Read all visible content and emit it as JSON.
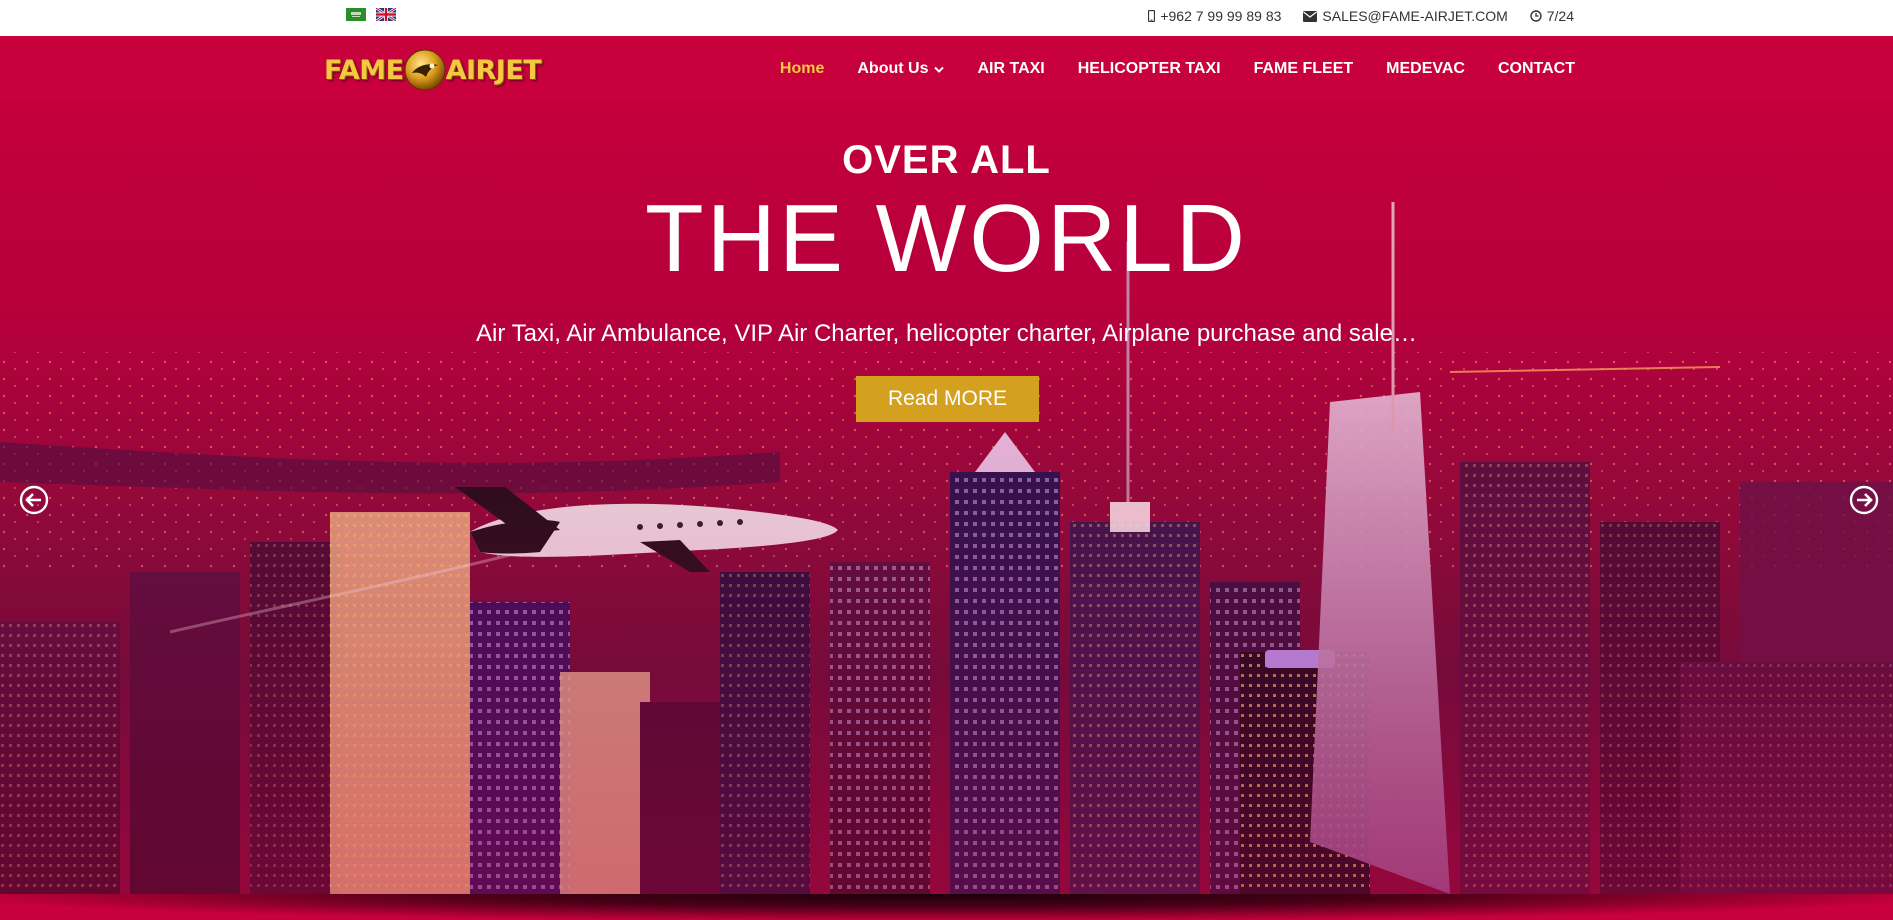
{
  "topbar": {
    "flags": [
      {
        "name": "arabic-flag-icon",
        "color": "#2a8c2a"
      },
      {
        "name": "uk-flag-icon",
        "color": "#1a3a8a"
      }
    ],
    "phone": "+962 7 99 99 89 83",
    "email": "SALES@FAME-AIRJET.COM",
    "hours": "7/24"
  },
  "navbar": {
    "logo_left": "FAME",
    "logo_right": "AIRJET",
    "items": [
      {
        "label": "Home",
        "active": true
      },
      {
        "label": "About Us",
        "dropdown": true
      },
      {
        "label": "AIR TAXI"
      },
      {
        "label": "HELICOPTER TAXI"
      },
      {
        "label": "FAME FLEET"
      },
      {
        "label": "MEDEVAC"
      },
      {
        "label": "CONTACT"
      }
    ]
  },
  "hero": {
    "title_small": "OVER ALL",
    "title_big": "THE WORLD",
    "subtitle": "Air Taxi, Air Ambulance, VIP Air Charter, helicopter charter, Airplane purchase and sale…",
    "button_label": "Read MORE"
  },
  "colors": {
    "brand": "#c8003c",
    "accent": "#f5c842",
    "button": "#d4a020"
  }
}
